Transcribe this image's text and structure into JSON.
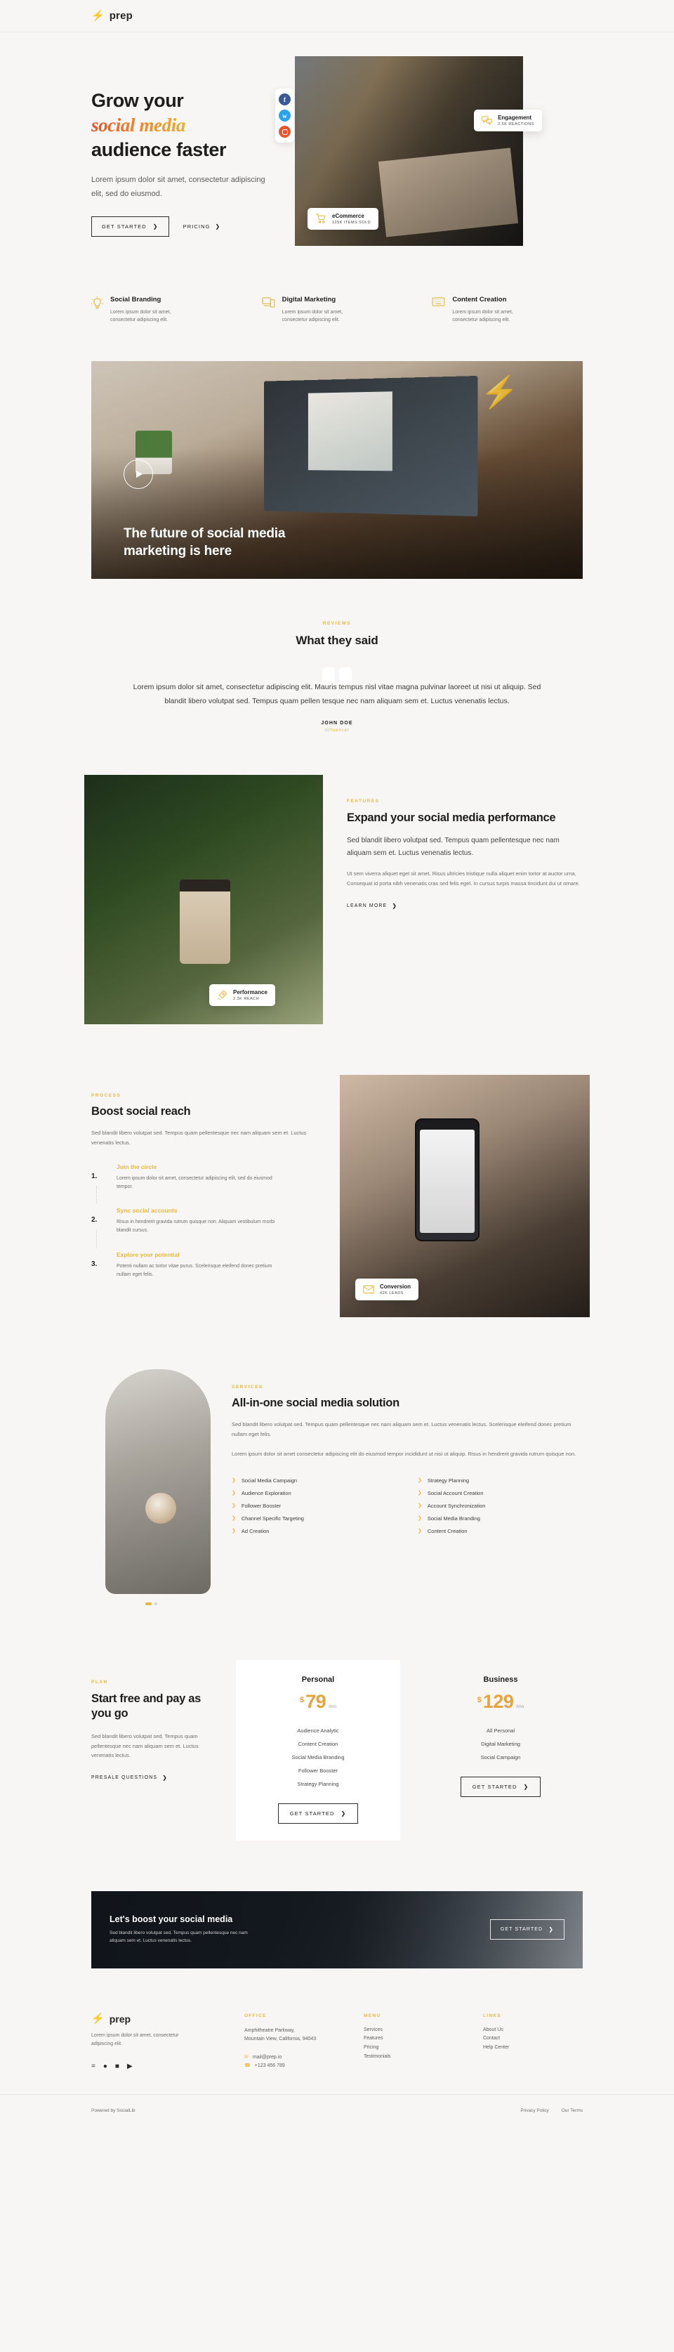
{
  "nav": {
    "brand": "prep",
    "logo_icon": "bolt-icon"
  },
  "hero": {
    "title_line1": "Grow your",
    "title_accent": "social media",
    "title_line3": "audience faster",
    "subtitle": "Lorem ipsum dolor sit amet, consectetur adipiscing elit, sed do eiusmod.",
    "primary_button": "GET STARTED",
    "secondary_button": "PRICING",
    "socials": [
      {
        "name": "facebook-icon",
        "glyph": "f"
      },
      {
        "name": "twitter-icon",
        "glyph": "t"
      },
      {
        "name": "instagram-icon",
        "glyph": ""
      }
    ],
    "badges": [
      {
        "title": "Engagement",
        "sub": "2.5K REACTIONS",
        "icon": "chat-bubbles-icon"
      },
      {
        "title": "eCommerce",
        "sub": "125K ITEMS SOLD",
        "icon": "shopping-cart-icon"
      }
    ]
  },
  "features3": [
    {
      "icon": "lightbulb-icon",
      "title": "Social Branding",
      "text": "Lorem ipsum dolor sit amet, consectetur adipiscing elit."
    },
    {
      "icon": "devices-icon",
      "title": "Digital Marketing",
      "text": "Lorem ipsum dolor sit amet, consectetur adipiscing elit."
    },
    {
      "icon": "keyboard-icon",
      "title": "Content Creation",
      "text": "Lorem ipsum dolor sit amet, consectetur adipiscing elit."
    }
  ],
  "video": {
    "caption_line1": "The future of social media",
    "caption_line2": "marketing is here",
    "play_icon": "play-icon"
  },
  "reviews": {
    "eyebrow": "REVIEWS",
    "heading": "What they said",
    "quote": "Lorem ipsum dolor sit amet, consectetur adipiscing elit. Mauris tempus nisl vitae magna pulvinar laoreet ut nisi ut aliquip. Sed blandit libero volutpat sed. Tempus quam pellen tesque nec nam aliquam sem et. Luctus venenatis lectus.",
    "author": "JOHN DOE",
    "role": "Influencer"
  },
  "expand": {
    "eyebrow": "FEATURES",
    "heading": "Expand your social media performance",
    "lead": "Sed blandit libero volutpat sed. Tempus quam pellentesque nec nam aliquam sem et. Luctus venenatis lectus.",
    "body": "Ut sem viverra aliquet eget sit amet. Risus ultricies tristique nulla aliquet enim tortor at auctor urna. Consequat id porta nibh venenatis cras sed felis eget. In cursus turpis massa tincidunt dui ut ornare.",
    "link": "LEARN MORE",
    "badge": {
      "title": "Performance",
      "sub": "2.3K REACH",
      "icon": "rocket-icon"
    }
  },
  "process": {
    "eyebrow": "PROCESS",
    "heading": "Boost social reach",
    "intro": "Sed blandit libero volutpat sed. Tempus quam pellentesque nec nam aliquam sem et. Luctus venenatis lectus.",
    "steps": [
      {
        "num": "1.",
        "title": "Join the circle",
        "text": "Lorem ipsum dolor sit amet, consectetur adipiscing elit, sed do eiusmod tempor."
      },
      {
        "num": "2.",
        "title": "Sync social accounts",
        "text": "Risus in hendrerit gravida rutrum quisque non. Aliquam vestibulum morbi blandit cursus."
      },
      {
        "num": "3.",
        "title": "Explore your potential",
        "text": "Potenti nullam ac tortor vitae purus. Scelerisque eleifend donec pretium nullam eget felis."
      }
    ],
    "badge": {
      "title": "Conversion",
      "sub": "42K LEADS",
      "icon": "envelope-icon"
    }
  },
  "services": {
    "eyebrow": "SERVICES",
    "heading": "All-in-one social media solution",
    "para1": "Sed blandit libero volutpat sed. Tempus quam pellentesque nec nam aliquam sem et. Luctus venenatis lectus. Scelerisque eleifend donec pretium nullam eget felis.",
    "para2": "Lorem ipsum dolor sit amet consectetur adipiscing elit do eiusmod tempor incididunt ut nisi ut aliquip. Risus in hendrerit gravida rutrum quisque non.",
    "list_left": [
      "Social Media Campaign",
      "Audience Exploration",
      "Follower Booster",
      "Channel Specific Targeting",
      "Ad Creation"
    ],
    "list_right": [
      "Strategy Planning",
      "Social Account Creation",
      "Account Synchronization",
      "Social Media Branding",
      "Content Creation"
    ]
  },
  "pricing": {
    "eyebrow": "PLAN",
    "heading": "Start free and pay as you go",
    "body": "Sed blandit libero volutpat sed. Tempus quam pellentesque nec nam aliquam sem et. Luctus venenatis lectus.",
    "link": "PRESALE QUESTIONS",
    "plans": [
      {
        "name": "Personal",
        "currency": "$",
        "amount": "79",
        "period": "/mo",
        "features": [
          "Audience Analytic",
          "Content Creation",
          "Social Media Branding",
          "Follower Booster",
          "Strategy Planning"
        ],
        "button": "GET STARTED",
        "highlight": true
      },
      {
        "name": "Business",
        "currency": "$",
        "amount": "129",
        "period": "/mo",
        "features": [
          "All Personal",
          "Digital Marketing",
          "Social Campaign"
        ],
        "button": "GET STARTED",
        "highlight": false
      }
    ]
  },
  "cta": {
    "heading": "Let's boost your social media",
    "text": "Sed blandit libero volutpat sed. Tempus quam pellentesque nec nam aliquam sem et. Luctus venenatis lectus.",
    "button": "GET STARTED"
  },
  "footer": {
    "brand": "prep",
    "about": "Lorem ipsum dolor sit amet, consectetur adipiscing elit.",
    "socials": [
      "facebook-icon",
      "twitter-icon",
      "instagram-icon",
      "youtube-icon"
    ],
    "office": {
      "head": "OFFICE",
      "line1": "Amphitheatre Parkway,",
      "line2": "Mountain View, California, 94043",
      "email": "mail@prep.io",
      "phone": "+123 456 789"
    },
    "menu": {
      "head": "MENU",
      "items": [
        "Services",
        "Features",
        "Pricing",
        "Testimonials"
      ]
    },
    "links": {
      "head": "LINKS",
      "items": [
        "About Us",
        "Contact",
        "Help Center"
      ]
    },
    "copyright": "Powered by SocialLib",
    "legal": [
      "Privacy Policy",
      "Our Terms"
    ]
  },
  "colors": {
    "accent": "#e8b73d",
    "accent_deep": "#e2502a",
    "bg": "#f7f6f4",
    "dark": "#1d1d1d"
  }
}
